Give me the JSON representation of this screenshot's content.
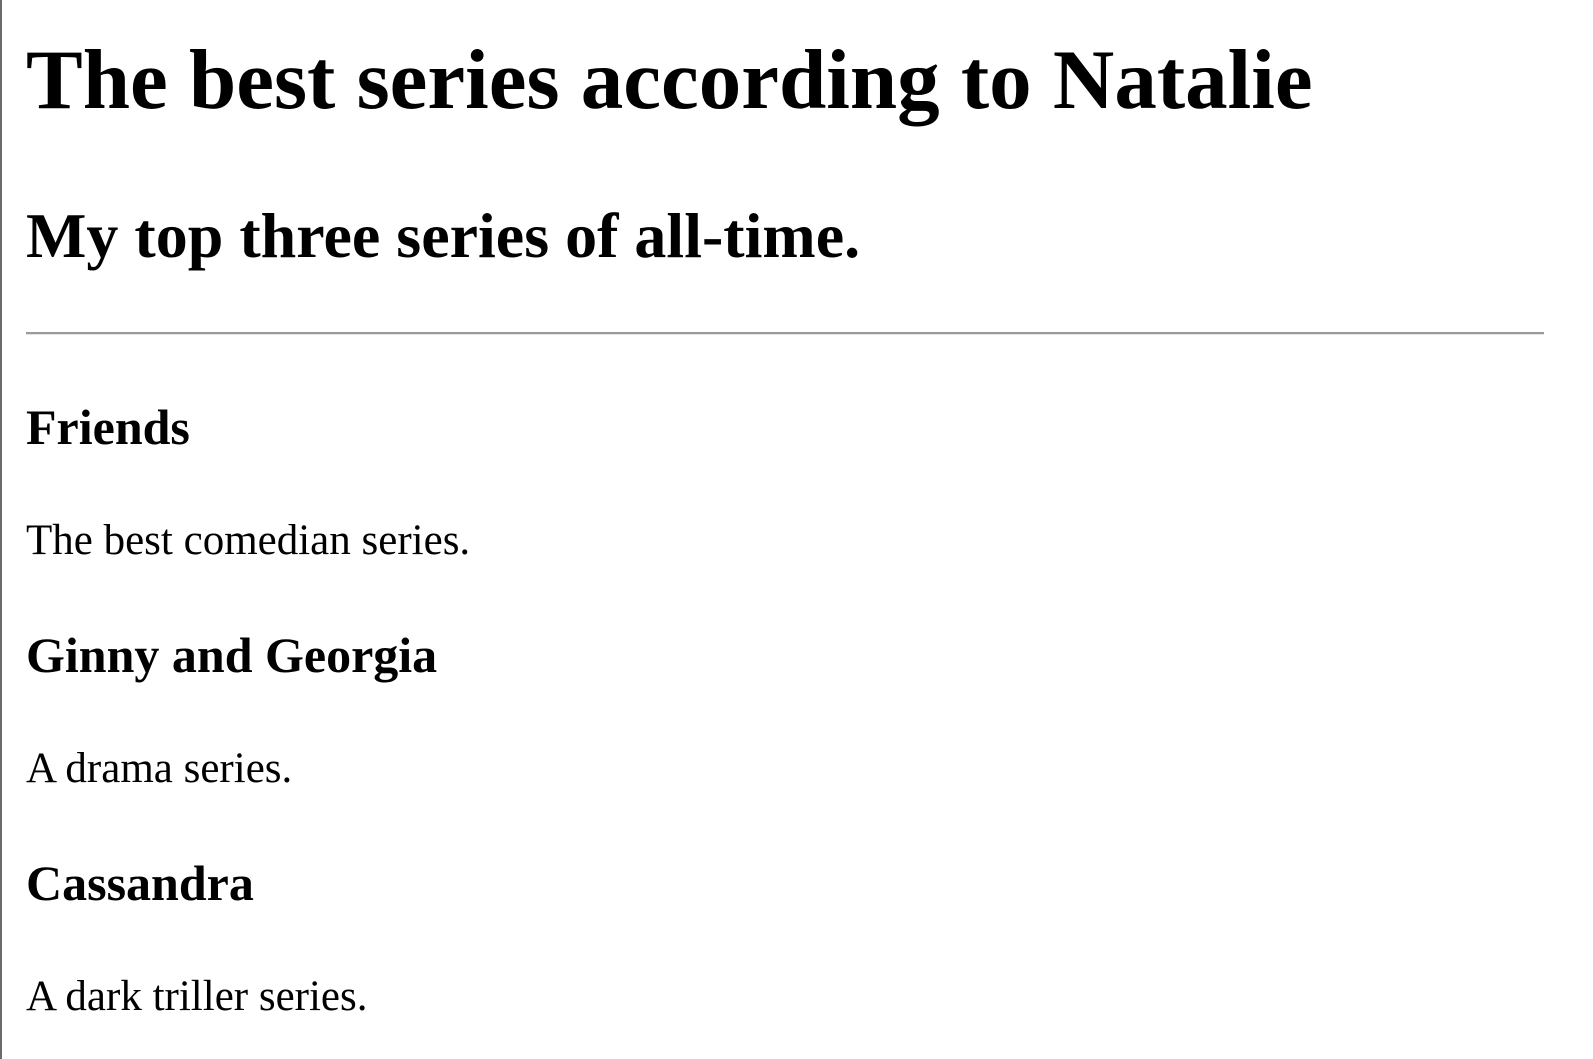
{
  "page": {
    "title": "The best series according to Natalie",
    "subtitle": "My top three series of all-time."
  },
  "series": [
    {
      "name": "Friends",
      "description": "The best comedian series."
    },
    {
      "name": "Ginny and Georgia",
      "description": "A drama series."
    },
    {
      "name": "Cassandra",
      "description": "A dark triller series."
    }
  ]
}
